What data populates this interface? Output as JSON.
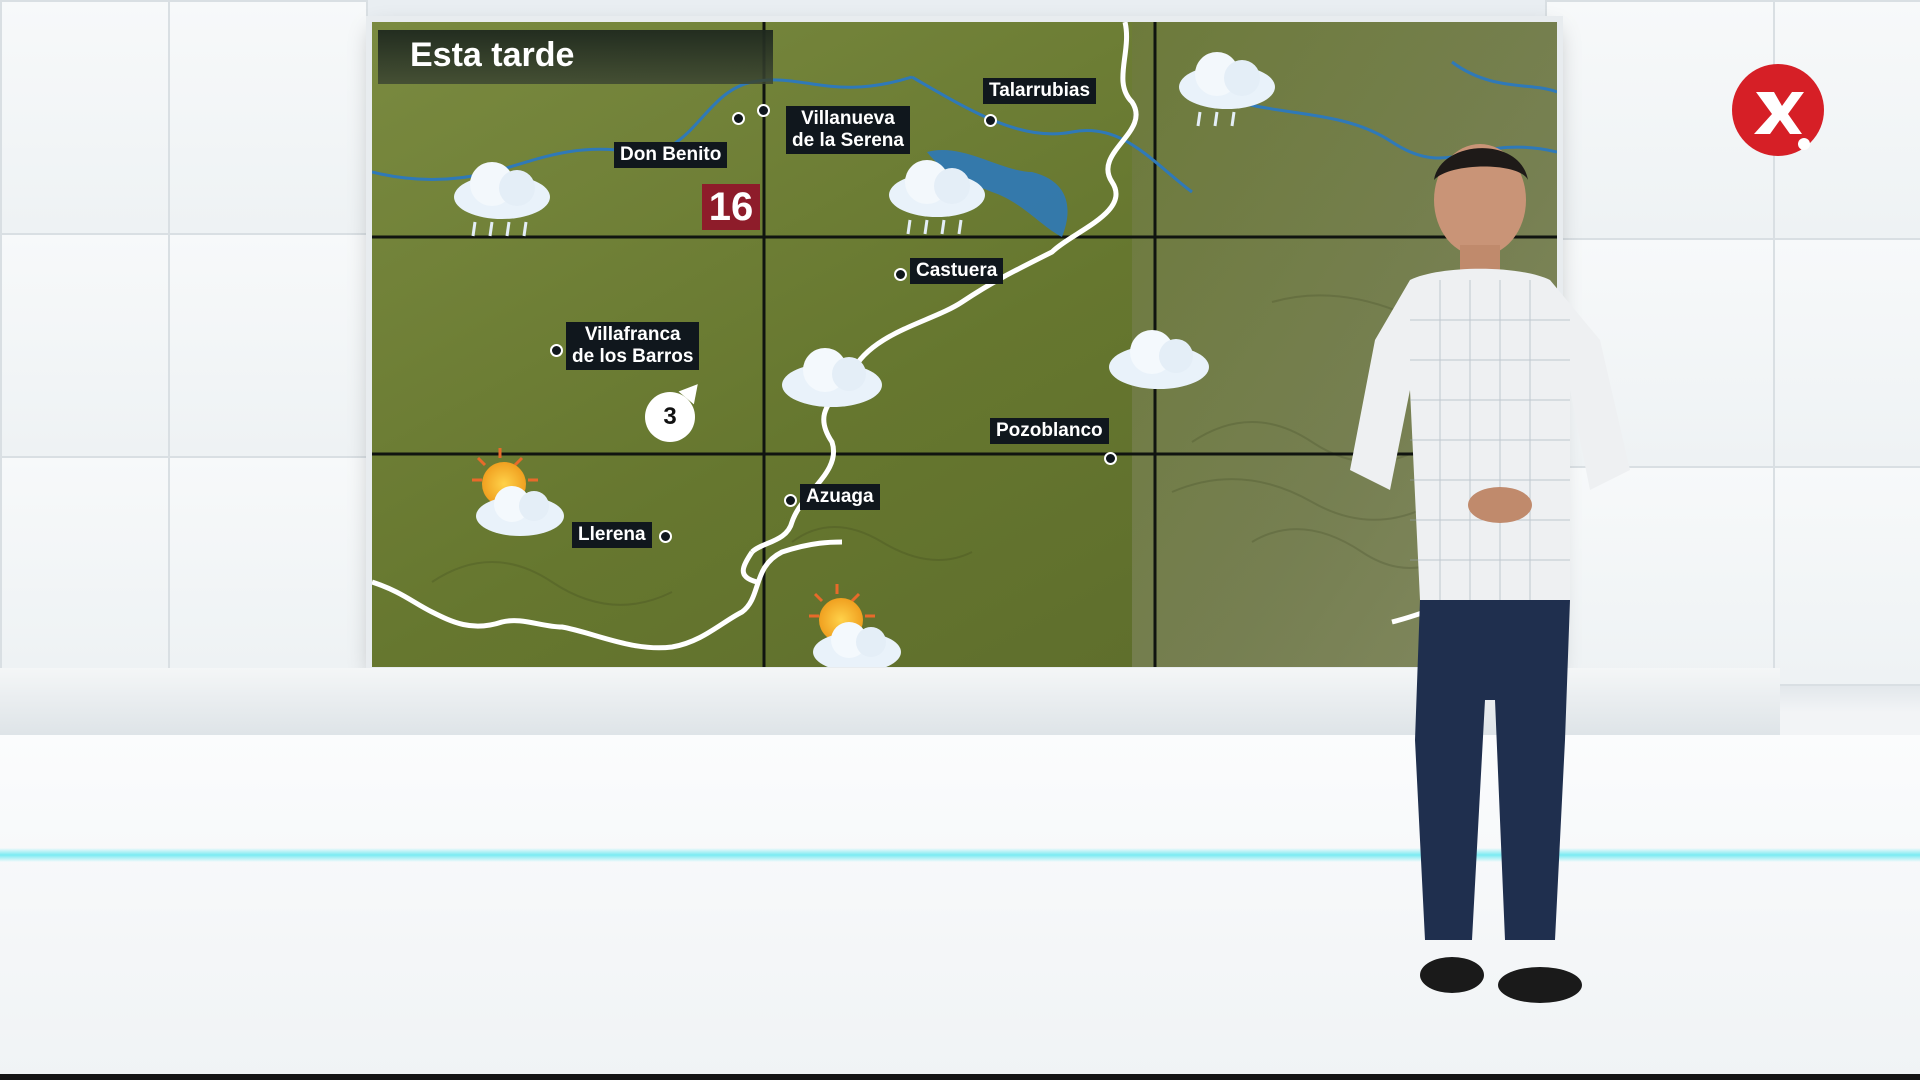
{
  "map": {
    "title": "Esta tarde",
    "cities": [
      {
        "id": "don-benito",
        "label": "Don Benito"
      },
      {
        "id": "villanueva",
        "label_line1": "Villanueva",
        "label_line2": "de la Serena"
      },
      {
        "id": "talarrubias",
        "label": "Talarrubias"
      },
      {
        "id": "castuera",
        "label": "Castuera"
      },
      {
        "id": "villafranca",
        "label_line1": "Villafranca",
        "label_line2": "de los Barros"
      },
      {
        "id": "pozoblanco",
        "label": "Pozoblanco"
      },
      {
        "id": "llerena",
        "label": "Llerena"
      },
      {
        "id": "azuaga",
        "label": "Azuaga"
      }
    ],
    "temperature": {
      "value": "16",
      "color": "#8e1c2a"
    },
    "wind": {
      "value": "3"
    },
    "icons": [
      "rain-cloud-icon",
      "cloud-icon",
      "partly-sunny-icon"
    ]
  },
  "colors": {
    "map_green": "#6d7a3a",
    "river_blue": "#2f79b8",
    "border_white": "#ffffff",
    "label_bg": "#10171d",
    "floor_glow": "#50e6f0"
  }
}
